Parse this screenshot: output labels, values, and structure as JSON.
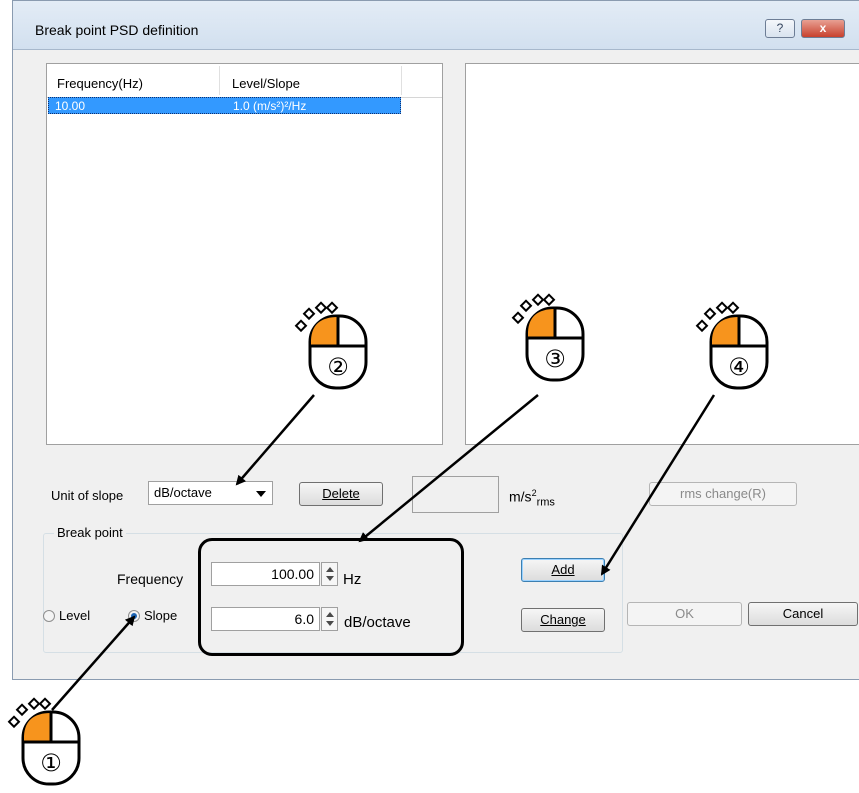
{
  "dialog": {
    "title": "Break point PSD definition",
    "help_icon": "?",
    "close_icon": "x"
  },
  "list": {
    "headers": [
      "Frequency(Hz)",
      "Level/Slope"
    ],
    "rows": [
      {
        "frequency": "10.00",
        "level": "1.0 (m/s²)²/Hz"
      }
    ]
  },
  "controls": {
    "unit_of_slope_label": "Unit of slope",
    "unit_of_slope_value": "dB/octave",
    "delete_label": "Delete",
    "rms_value": "",
    "rms_unit_main": "m/s",
    "rms_unit_sup": "2",
    "rms_unit_sub": "rms",
    "rms_change_label": "rms change(R)"
  },
  "breakpoint": {
    "group_title": "Break point",
    "frequency_label": "Frequency",
    "frequency_value": "100.00",
    "frequency_unit": "Hz",
    "level_label": "Level",
    "slope_label": "Slope",
    "slope_value": "6.0",
    "slope_unit": "dB/octave",
    "selected_mode": "Slope"
  },
  "buttons": {
    "add": "Add",
    "change": "Change",
    "ok": "OK",
    "cancel": "Cancel"
  },
  "annotations": {
    "steps": [
      "①",
      "②",
      "③",
      "④"
    ],
    "mouse_icon": "mouse-left-click-icon",
    "accent_color": "#f7941d"
  }
}
